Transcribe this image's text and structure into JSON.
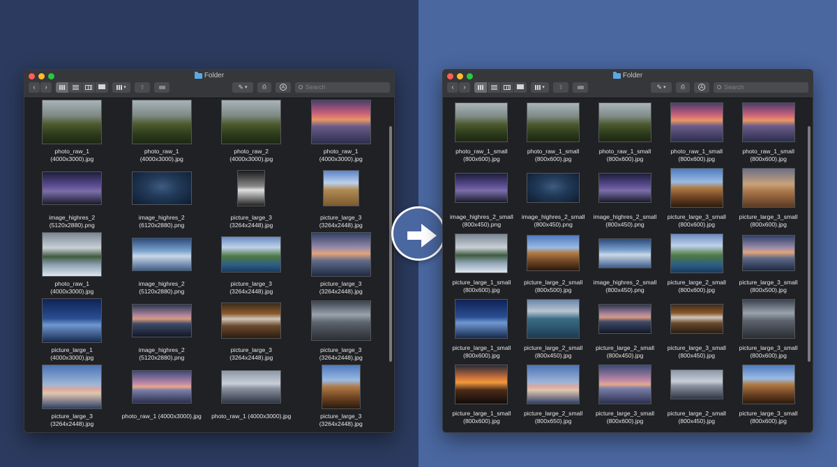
{
  "left_window": {
    "title": "Folder",
    "search_placeholder": "Search",
    "files": [
      {
        "name": "photo_raw_1",
        "dims": "(4000x3000).jpg",
        "style": "g-mountain"
      },
      {
        "name": "photo_raw_1",
        "dims": "(4000x3000).jpg",
        "style": "g-mountain"
      },
      {
        "name": "photo_raw_2",
        "dims": "(4000x3000).jpg",
        "style": "g-mountain"
      },
      {
        "name": "photo_raw_1",
        "dims": "(4000x3000).jpg",
        "style": "g-sunset"
      },
      {
        "name": "image_highres_2",
        "dims": "(5120x2880).png",
        "style": "g-night"
      },
      {
        "name": "image_highres_2",
        "dims": "(6120x2880).png",
        "style": "g-island"
      },
      {
        "name": "picture_large_3",
        "dims": "(3264x2448).jpg",
        "style": "g-bw"
      },
      {
        "name": "picture_large_3",
        "dims": "(3264x2448).jpg",
        "style": "g-road"
      },
      {
        "name": "photo_raw_1",
        "dims": "(4000x3000).jpg",
        "style": "g-coast"
      },
      {
        "name": "image_highres_2",
        "dims": "(5120x2880).png",
        "style": "g-lake"
      },
      {
        "name": "picture_large_3",
        "dims": "(3264x2448).jpg",
        "style": "g-cliff"
      },
      {
        "name": "picture_large_3",
        "dims": "(3264x2448).jpg",
        "style": "g-dusk"
      },
      {
        "name": "picture_large_1",
        "dims": "(4000x3000).jpg",
        "style": "g-pier"
      },
      {
        "name": "image_highres_2",
        "dims": "(5120x2880).png",
        "style": "g-water"
      },
      {
        "name": "picture_large_3",
        "dims": "(3264x2448).jpg",
        "style": "g-falls"
      },
      {
        "name": "picture_large_3",
        "dims": "(3264x2448).jpg",
        "style": "g-storm"
      },
      {
        "name": "picture_large_3",
        "dims": "(3264x2448).jpg",
        "style": "g-warm"
      },
      {
        "name": "photo_raw_1 (4000x3000).jpg",
        "dims": "",
        "style": "g-pink"
      },
      {
        "name": "photo_raw_1 (4000x3000).jpg",
        "dims": "",
        "style": "g-grey"
      },
      {
        "name": "picture_large_3",
        "dims": "(3264x2448).jpg",
        "style": "g-rock"
      }
    ]
  },
  "right_window": {
    "title": "Folder",
    "search_placeholder": "Search",
    "files": [
      {
        "name": "photo_raw_1_small",
        "dims": "(800x600).jpg",
        "style": "g-mountain"
      },
      {
        "name": "photo_raw_1_small",
        "dims": "(800x600).jpg",
        "style": "g-mountain"
      },
      {
        "name": "photo_raw_1_small",
        "dims": "(800x600).jpg",
        "style": "g-mountain"
      },
      {
        "name": "photo_raw_1_small",
        "dims": "(800x600).jpg",
        "style": "g-sunset"
      },
      {
        "name": "photo_raw_1_small",
        "dims": "(800x600).jpg",
        "style": "g-sunset"
      },
      {
        "name": "image_highres_2_small",
        "dims": "(800x450).png",
        "style": "g-night"
      },
      {
        "name": "image_highres_2_small",
        "dims": "(800x450).png",
        "style": "g-island"
      },
      {
        "name": "image_highres_2_small",
        "dims": "(800x450).png",
        "style": "g-night"
      },
      {
        "name": "picture_large_3_small",
        "dims": "(800x600).jpg",
        "style": "g-rock"
      },
      {
        "name": "picture_large_3_small",
        "dims": "(800x600).jpg",
        "style": "g-desert"
      },
      {
        "name": "picture_large_1_small",
        "dims": "(800x600).jpg",
        "style": "g-coast"
      },
      {
        "name": "picture_large_2_small",
        "dims": "(800x500).jpg",
        "style": "g-rock"
      },
      {
        "name": "image_highres_2_small",
        "dims": "(800x450).png",
        "style": "g-lake"
      },
      {
        "name": "picture_large_2_small",
        "dims": "(800x600).jpg",
        "style": "g-cliff"
      },
      {
        "name": "picture_large_3_small",
        "dims": "(800x500).jpg",
        "style": "g-dusk"
      },
      {
        "name": "picture_large_1_small",
        "dims": "(800x600).jpg",
        "style": "g-pier"
      },
      {
        "name": "picture_large_2_small",
        "dims": "(800x450).jpg",
        "style": "g-sea"
      },
      {
        "name": "picture_large_2_small",
        "dims": "(800x450).jpg",
        "style": "g-water"
      },
      {
        "name": "picture_large_3_small",
        "dims": "(800x450).jpg",
        "style": "g-falls"
      },
      {
        "name": "picture_large_3_small",
        "dims": "(800x600).jpg",
        "style": "g-storm"
      },
      {
        "name": "picture_large_1_small",
        "dims": "(800x600).jpg",
        "style": "g-fire"
      },
      {
        "name": "picture_large_2_small",
        "dims": "(800x650).jpg",
        "style": "g-warm"
      },
      {
        "name": "picture_large_3_small",
        "dims": "(800x600).jpg",
        "style": "g-pink"
      },
      {
        "name": "picture_large_2_small",
        "dims": "(800x450).jpg",
        "style": "g-grey"
      },
      {
        "name": "picture_large_3_small",
        "dims": "(800x600).jpg",
        "style": "g-rock"
      }
    ]
  },
  "colors": {
    "background_left": "#2b3a5e",
    "background_right": "#4a67a0",
    "window": "#1f2023",
    "traffic_red": "#fe5f57",
    "traffic_yellow": "#febc2e",
    "traffic_green": "#28c840",
    "folder_icon": "#5aa9e6"
  },
  "icons": {
    "arrow": "right-arrow-icon",
    "folder": "folder-icon"
  }
}
